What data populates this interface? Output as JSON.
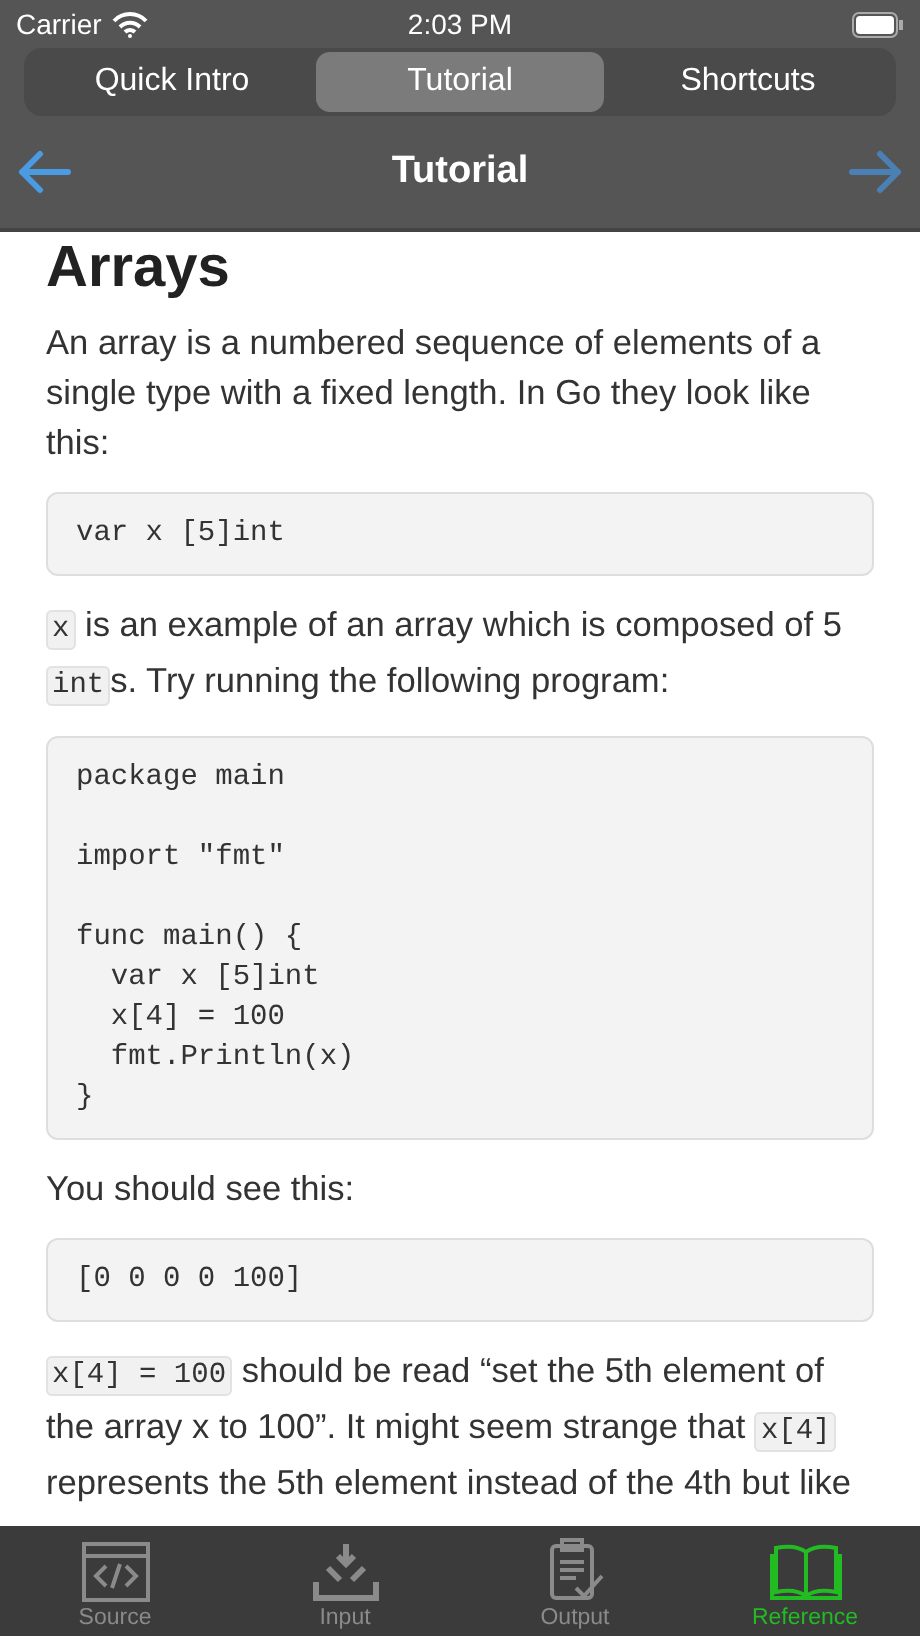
{
  "status_bar": {
    "carrier": "Carrier",
    "time": "2:03 PM"
  },
  "segments": [
    {
      "label": "Quick Intro",
      "selected": false
    },
    {
      "label": "Tutorial",
      "selected": true
    },
    {
      "label": "Shortcuts",
      "selected": false
    }
  ],
  "nav_bar": {
    "title": "Tutorial"
  },
  "content": [
    {
      "kind": "heading",
      "text": "Arrays"
    },
    {
      "kind": "paragraph",
      "parts": [
        {
          "kind": "text",
          "text": "An array is a numbered sequence of elements of a single type with a fixed length. In Go they look like this:"
        }
      ]
    },
    {
      "kind": "code",
      "groups": [
        [
          "var x [5]int"
        ]
      ]
    },
    {
      "kind": "paragraph",
      "parts": [
        {
          "kind": "code",
          "text": "x"
        },
        {
          "kind": "text",
          "text": " is an example of an array which is composed of 5 "
        },
        {
          "kind": "code",
          "text": "int"
        },
        {
          "kind": "text",
          "text": "s. Try running the following program:"
        }
      ]
    },
    {
      "kind": "code",
      "groups": [
        [
          "package main"
        ],
        [
          "import \"fmt\""
        ],
        [
          "func main() {",
          "  var x [5]int",
          "  x[4] = 100",
          "  fmt.Println(x)",
          "}"
        ]
      ]
    },
    {
      "kind": "paragraph",
      "parts": [
        {
          "kind": "text",
          "text": "You should see this:"
        }
      ]
    },
    {
      "kind": "code",
      "groups": [
        [
          "[0 0 0 0 100]"
        ]
      ]
    },
    {
      "kind": "paragraph",
      "parts": [
        {
          "kind": "code",
          "text": "x[4] = 100"
        },
        {
          "kind": "text",
          "text": " should be read “set the 5th element of the array x to 100”. It might seem strange that "
        },
        {
          "kind": "code",
          "text": "x[4]"
        },
        {
          "kind": "text",
          "text": " represents the 5th element instead of the 4th but like"
        }
      ]
    }
  ],
  "tab_bar": [
    {
      "label": "Source",
      "kind": "source",
      "selected": false
    },
    {
      "label": "Input",
      "kind": "input",
      "selected": false
    },
    {
      "label": "Output",
      "kind": "output",
      "selected": false
    },
    {
      "label": "Reference",
      "kind": "reference",
      "selected": true
    }
  ]
}
